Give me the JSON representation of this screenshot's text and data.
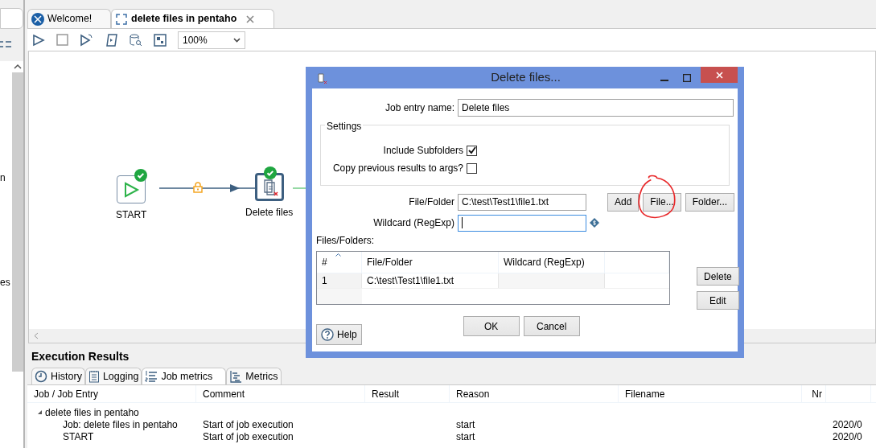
{
  "left_panel": {
    "fragments": [
      "n",
      "es"
    ]
  },
  "editor_tabs": [
    {
      "label": "Welcome!",
      "selected": false,
      "closable": false
    },
    {
      "label": "delete files in pentaho",
      "selected": true,
      "closable": true
    }
  ],
  "toolbar": {
    "zoom": "100%"
  },
  "canvas": {
    "nodes": [
      {
        "label": "START",
        "kind": "start",
        "status_ok": true,
        "selected": false
      },
      {
        "label": "Delete files",
        "kind": "delete",
        "status_ok": true,
        "selected": true
      }
    ]
  },
  "execution_results": {
    "title": "Execution Results",
    "tabs": [
      {
        "label": "History",
        "kind": "history",
        "selected": false
      },
      {
        "label": "Logging",
        "kind": "logging",
        "selected": false
      },
      {
        "label": "Job metrics",
        "kind": "metrics_list",
        "selected": true
      },
      {
        "label": "Metrics",
        "kind": "gantt",
        "selected": false
      }
    ],
    "columns": [
      "Job / Job Entry",
      "Comment",
      "Result",
      "Reason",
      "Filename",
      "Nr"
    ],
    "rows": [
      {
        "job_entry": "delete files in pentaho",
        "expanded": true,
        "children": [
          {
            "job_entry": "Job: delete files in pentaho",
            "comment": "Start of job execution",
            "reason": "start",
            "column_7": "2020/0"
          },
          {
            "job_entry": "START",
            "comment": "Start of job execution",
            "reason": "start",
            "column_7": "2020/0"
          }
        ]
      }
    ]
  },
  "dialog": {
    "title": "Delete files...",
    "job_entry_name": {
      "label": "Job entry name:",
      "value": "Delete files"
    },
    "settings": {
      "title": "Settings",
      "checkboxes": [
        {
          "label": "Include Subfolders",
          "checked": true
        },
        {
          "label": "Copy previous results to args?",
          "checked": false
        }
      ]
    },
    "file_folder": {
      "label": "File/Folder",
      "value": "C:\\test\\Test1\\file1.txt"
    },
    "wildcard": {
      "label": "Wildcard (RegExp)",
      "focused": true
    },
    "file_buttons": [
      {
        "label": "Add",
        "circled": false
      },
      {
        "label": "File...",
        "circled": true
      },
      {
        "label": "Folder...",
        "circled": false
      }
    ],
    "files_table": {
      "title": "Files/Folders:",
      "columns": [
        "#",
        "File/Folder",
        "Wildcard (RegExp)"
      ],
      "rows": [
        {
          "number": "1",
          "file_folder": "C:\\test\\Test1\\file1.txt"
        }
      ]
    },
    "side_buttons": [
      "Delete",
      "Edit"
    ],
    "footer_buttons": [
      "OK",
      "Cancel"
    ],
    "help": "Help"
  }
}
